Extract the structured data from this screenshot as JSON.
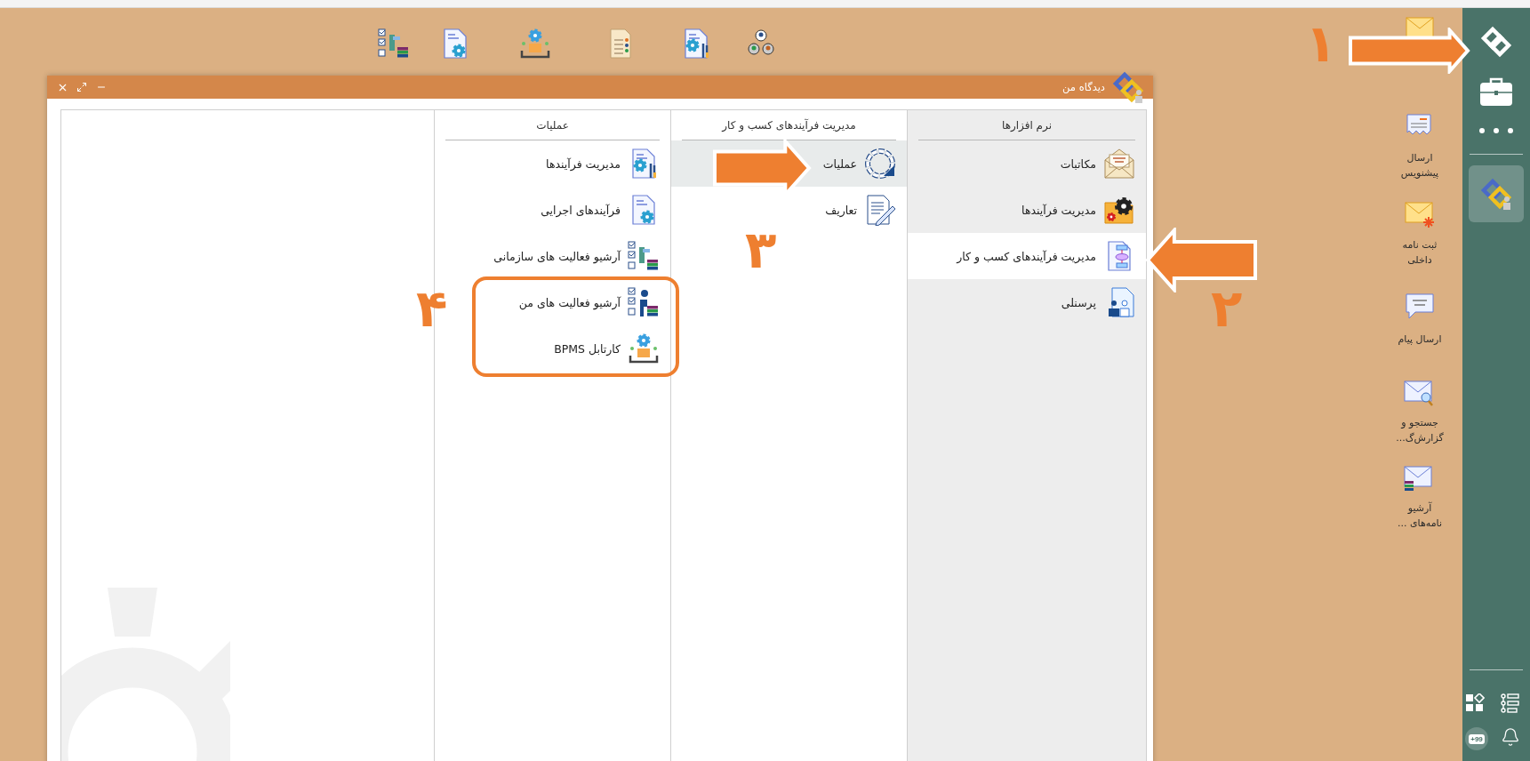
{
  "desktop_shortcuts": [
    {
      "label": "ارسال پیشنویس"
    },
    {
      "label": "ثبت نامه داخلی"
    },
    {
      "label": "ارسال پیام"
    },
    {
      "label": "جستجو و گزارش‌گ..."
    },
    {
      "label": "آرشیو نامه‌های ..."
    }
  ],
  "window": {
    "title": "دیدگاه من",
    "columns": [
      {
        "header": "نرم افزارها",
        "items": [
          {
            "label": "مکاتبات",
            "selected": false
          },
          {
            "label": "مدیریت فرآیندها",
            "selected": false
          },
          {
            "label": "مدیریت فرآیندهای کسب و کار",
            "selected": true
          },
          {
            "label": "پرسنلی",
            "selected": false
          }
        ]
      },
      {
        "header": "مدیریت فرآیندهای کسب و کار",
        "items": [
          {
            "label": "عملیات",
            "selected": true
          },
          {
            "label": "تعاریف",
            "selected": false
          }
        ]
      },
      {
        "header": "عملیات",
        "items": [
          {
            "label": "مدیریت فرآیندها",
            "selected": false
          },
          {
            "label": "فرآیندهای اجرایی",
            "selected": false
          },
          {
            "label": "آرشیو فعالیت های سازمانی",
            "selected": false
          },
          {
            "label": "آرشیو فعالیت های من",
            "selected": false
          },
          {
            "label": "کارتابل BPMS",
            "selected": false
          }
        ]
      }
    ]
  },
  "sidebar": {
    "apps": [
      {
        "selected": true
      }
    ],
    "chat_badge": "+99"
  },
  "annotations": [
    {
      "kind": "right-arrow"
    },
    {
      "kind": "left-arrow"
    },
    {
      "kind": "right-arrow"
    },
    {
      "kind": "frame"
    }
  ],
  "step_numbers": [
    {
      "text": "۱"
    },
    {
      "text": "۲"
    },
    {
      "text": "۳"
    },
    {
      "text": "۴"
    }
  ]
}
